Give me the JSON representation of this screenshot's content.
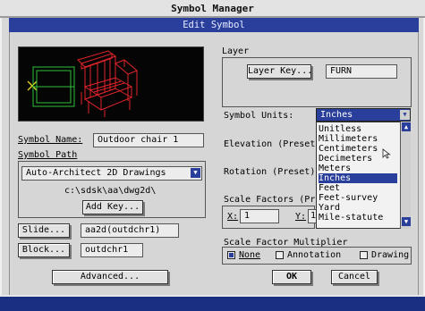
{
  "window": {
    "title": "Symbol Manager",
    "dialog_title": "Edit Symbol"
  },
  "symbol": {
    "name_label": "Symbol Name:",
    "name_value": "Outdoor chair 1",
    "path_label": "Symbol Path",
    "path_value": "Auto-Architect 2D Drawings",
    "dir_text": "c:\\sdsk\\aa\\dwg2d\\",
    "add_key_label": "Add Key..."
  },
  "slide": {
    "button": "Slide...",
    "value": "aa2d(outdchr1)"
  },
  "block": {
    "button": "Block...",
    "value": "outdchr1"
  },
  "advanced_label": "Advanced...",
  "layer": {
    "label": "Layer",
    "key_button": "Layer Key...",
    "value": "FURN"
  },
  "units": {
    "label": "Symbol Units:",
    "selected": "Inches",
    "options": [
      "Unitless",
      "Millimeters",
      "Centimeters",
      "Decimeters",
      "Meters",
      "Inches",
      "Feet",
      "Feet-survey",
      "Yard",
      "Mile-statute"
    ],
    "selected_index": 5
  },
  "elevation_label": "Elevation (Preset)",
  "rotation_label": "Rotation  (Preset)",
  "scale": {
    "label": "Scale Factors (Pr",
    "x_label": "X:",
    "x_value": "1",
    "y_label": "Y:",
    "y_value": "1"
  },
  "multiplier": {
    "label": "Scale Factor Multiplier",
    "options": [
      "None",
      "Annotation",
      "Drawing"
    ],
    "selected": "None"
  },
  "ok_label": "OK",
  "cancel_label": "Cancel",
  "colors": {
    "accent": "#2a3f9c",
    "preview_bg": "#050505",
    "chair_red": "#e0242a",
    "chair_green": "#2fbf3a",
    "marker_yellow": "#e6d21f"
  }
}
